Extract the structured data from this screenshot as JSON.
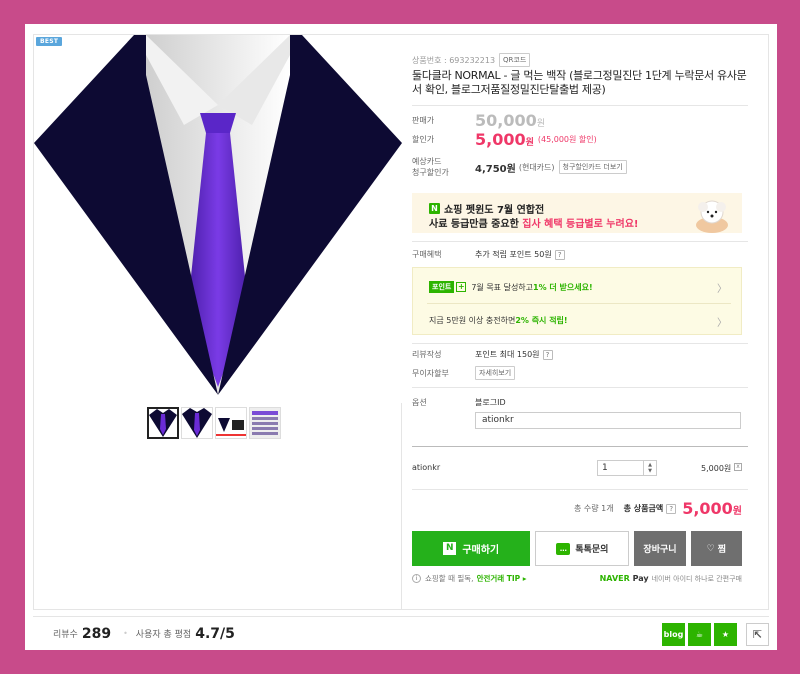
{
  "badge": "BEST",
  "product": {
    "code_label": "상품번호 : 693232213",
    "qr_label": "QR코드",
    "title": "둘다클라 NORMAL - 글 먹는 백작 (블로그정밀진단 1단계 누락문서 유사문서 확인, 블로그저품질정밀진단탈출법 제공)"
  },
  "price": {
    "original_label": "판매가",
    "original": "50,000",
    "original_unit": "원",
    "sale_label": "할인가",
    "sale": "5,000",
    "sale_unit": "원",
    "sale_note": "(45,000원 할인)",
    "card_label_1": "예상카드",
    "card_label_2": "청구할인가",
    "card_price": "4,750원",
    "card_note": "(현대카드)",
    "card_btn": "청구할인카드 더보기"
  },
  "banner": {
    "line1": "쇼핑 펫윈도 7월 연합전",
    "line2_a": "사료 등급만큼 중요한 ",
    "line2_b": "집사 혜택 등급별로 누려요!"
  },
  "benefit": {
    "label": "구매혜택",
    "value": "추가 적립 포인트 50원",
    "points_badge": "포인트",
    "line1_a": "7월 목표 달성하고 ",
    "line1_b": "1% 더 받으세요!",
    "line2_a": "지금 5만원 이상 충전하면 ",
    "line2_b": "2% 즉시 적립!"
  },
  "review": {
    "label": "리뷰작성",
    "value": "포인트 최대 150원"
  },
  "installment": {
    "label": "무이자할부",
    "btn": "자세히보기"
  },
  "option": {
    "label": "옵션",
    "field_label": "블로그ID",
    "field_value": "ationkr"
  },
  "selected": {
    "name": "ationkr",
    "qty": "1",
    "price": "5,000원",
    "remove": "x"
  },
  "total": {
    "qty_text": "총 수량 1개",
    "label": "총 상품금액",
    "price": "5,000",
    "unit": "원"
  },
  "buttons": {
    "buy": "구매하기",
    "talk": "톡톡문의",
    "cart": "장바구니",
    "zzim": "찜"
  },
  "footer": {
    "note": "쇼핑할 때 필독,",
    "tip": "안전거래 TIP ▸",
    "npay_a": "NAVER",
    "npay_b": "Pay",
    "npay_sub": "네이버 아이디 하나로 간편구매"
  },
  "bottom": {
    "review_label": "리뷰수",
    "review_count": "289",
    "rating_label": "사용자 총 평점",
    "rating": "4.7",
    "rating_max": "/5"
  },
  "colors": {
    "background": "#c84b8a",
    "sale": "#ef3768",
    "naver_green": "#2db400",
    "suit_navy": "#0d0a33",
    "tie_purple": "#6a2bd6"
  }
}
